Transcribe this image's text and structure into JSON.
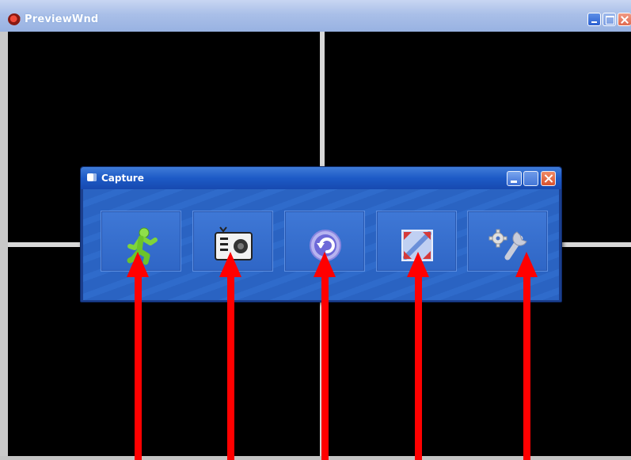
{
  "outer_window": {
    "title": "PreviewWnd",
    "icon": "app-ladybug-icon",
    "controls": [
      "minimize-icon",
      "maximize-icon",
      "close-icon"
    ]
  },
  "video_grid": {
    "layout": "2x2",
    "panes": [
      "channel-1",
      "channel-2",
      "channel-3",
      "channel-4"
    ]
  },
  "capture_dialog": {
    "title": "Capture",
    "icon": "capture-window-icon",
    "controls": [
      "minimize-icon",
      "maximize-icon",
      "close-icon"
    ],
    "tools": [
      {
        "id": "run",
        "icon": "running-man-icon"
      },
      {
        "id": "snapshot",
        "icon": "camera-snapshot-icon"
      },
      {
        "id": "back",
        "icon": "circular-arrow-back-icon"
      },
      {
        "id": "fullscreen",
        "icon": "fullscreen-expand-icon"
      },
      {
        "id": "settings",
        "icon": "gear-wrench-settings-icon"
      }
    ]
  },
  "annotations": {
    "arrow_color": "#ff0000",
    "count": 5
  },
  "colors": {
    "outer_titlebar": "#a9bfe8",
    "capture_titlebar": "#1d5ac6",
    "capture_body": "#2a63c2",
    "video_background": "#000000"
  }
}
